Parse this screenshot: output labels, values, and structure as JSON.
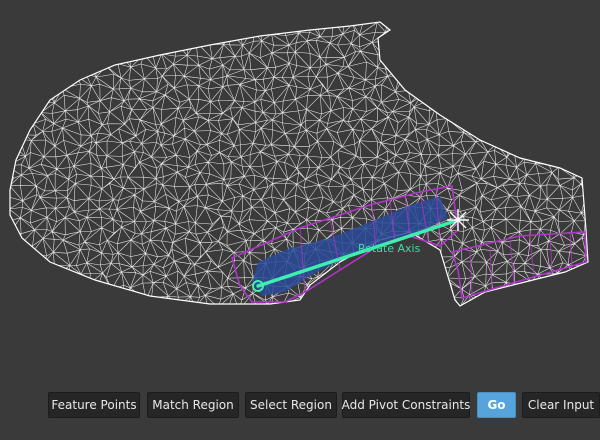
{
  "viewport": {
    "axis_label": "Rotate Axis",
    "colors": {
      "background": "#3a3a3a",
      "mesh_wire": "#ffffff",
      "region_outline": "#b035c9",
      "selected_fill": "#2a4b9a",
      "axis": "#3df0b0",
      "axis_label": "#39e0a8"
    }
  },
  "toolbar": {
    "feature_points": "Feature Points",
    "match_region": "Match Region",
    "select_region": "Select Region",
    "add_pivot_constraints": "Add Pivot Constraints",
    "go": "Go",
    "clear_input": "Clear Input"
  }
}
